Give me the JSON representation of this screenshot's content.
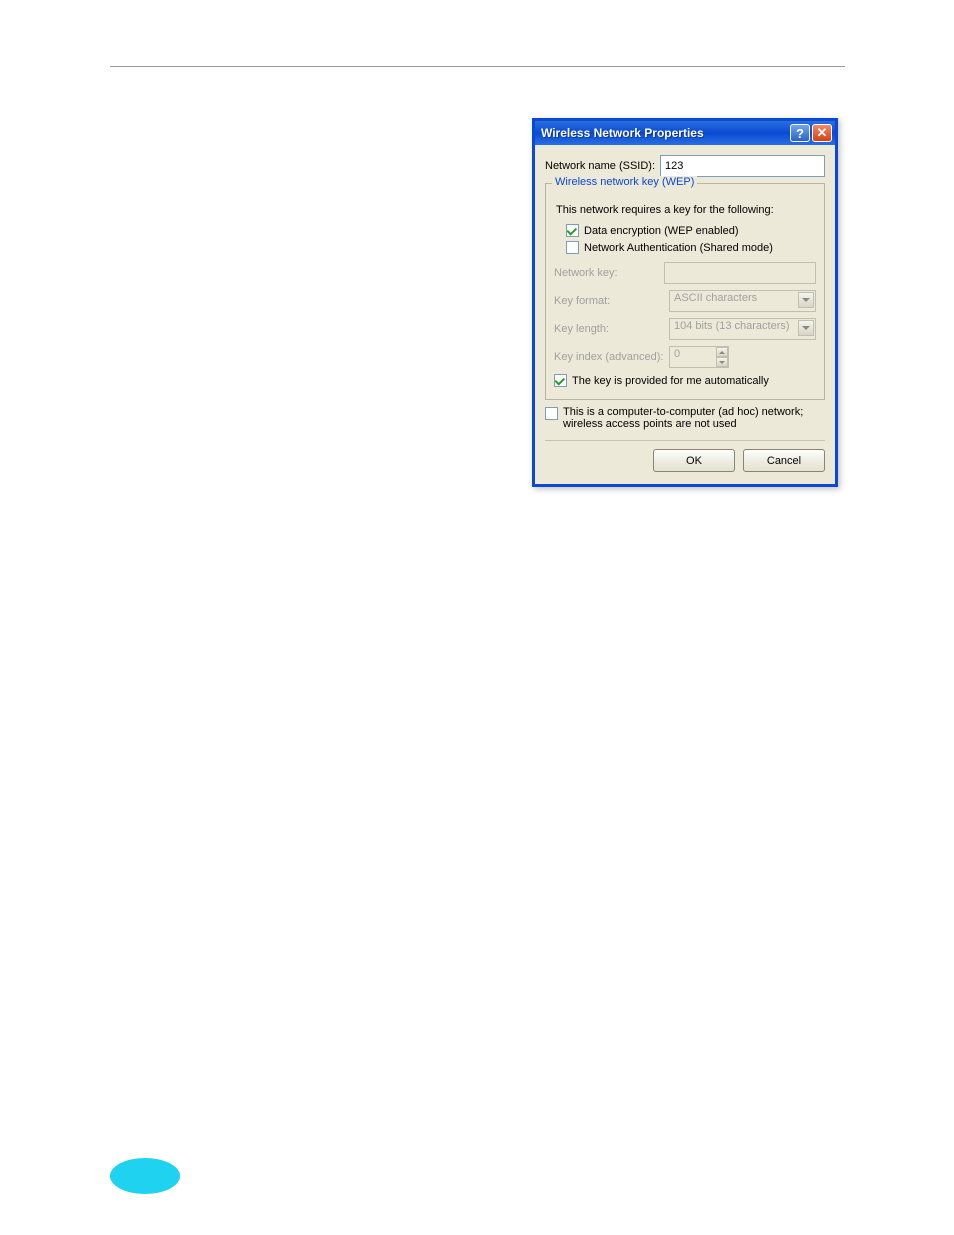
{
  "dialog": {
    "title": "Wireless Network Properties",
    "ssid_label": "Network name (SSID):",
    "ssid_value": "123",
    "wep_legend": "Wireless network key (WEP)",
    "requires_note": "This network requires a key for the following:",
    "cb_data_encryption": "Data encryption (WEP enabled)",
    "cb_network_auth": "Network Authentication (Shared mode)",
    "network_key_label": "Network key:",
    "network_key_value": "",
    "key_format_label": "Key format:",
    "key_format_value": "ASCII characters",
    "key_length_label": "Key length:",
    "key_length_value": "104 bits (13 characters)",
    "key_index_label": "Key index (advanced):",
    "key_index_value": "0",
    "cb_auto_key": "The key is provided for me automatically",
    "cb_adhoc": "This is a computer-to-computer (ad hoc) network; wireless access points are not used",
    "ok": "OK",
    "cancel": "Cancel"
  }
}
